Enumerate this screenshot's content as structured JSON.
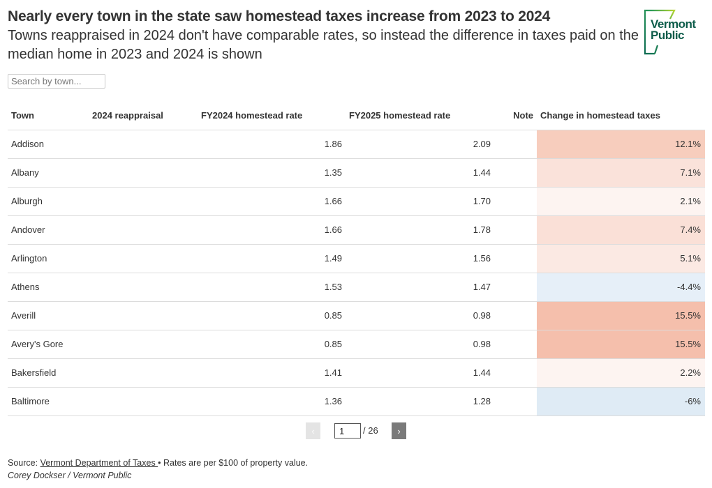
{
  "header": {
    "title": "Nearly every town in the state saw homestead taxes increase from 2023 to 2024",
    "subtitle": "Towns reappraised in 2024 don't have comparable rates, so instead the difference in taxes paid on the median home in 2023 and 2024 is shown"
  },
  "logo": {
    "line1": "Vermont",
    "line2": "Public",
    "icon": "vermont-public-logo"
  },
  "search": {
    "placeholder": "Search by town...",
    "value": ""
  },
  "table": {
    "columns": [
      "Town",
      "2024 reappraisal",
      "FY2024 homestead rate",
      "FY2025 homestead rate",
      "Note",
      "Change in homestead taxes"
    ],
    "rows": [
      {
        "town": "Addison",
        "reappraisal": "",
        "fy2024": "1.86",
        "fy2025": "2.09",
        "note": "",
        "change": "12.1%",
        "change_value": 12.1,
        "color": "#f7cdbd"
      },
      {
        "town": "Albany",
        "reappraisal": "",
        "fy2024": "1.35",
        "fy2025": "1.44",
        "note": "",
        "change": "7.1%",
        "change_value": 7.1,
        "color": "#fae2da"
      },
      {
        "town": "Alburgh",
        "reappraisal": "",
        "fy2024": "1.66",
        "fy2025": "1.70",
        "note": "",
        "change": "2.1%",
        "change_value": 2.1,
        "color": "#fdf4f1"
      },
      {
        "town": "Andover",
        "reappraisal": "",
        "fy2024": "1.66",
        "fy2025": "1.78",
        "note": "",
        "change": "7.4%",
        "change_value": 7.4,
        "color": "#fae0d7"
      },
      {
        "town": "Arlington",
        "reappraisal": "",
        "fy2024": "1.49",
        "fy2025": "1.56",
        "note": "",
        "change": "5.1%",
        "change_value": 5.1,
        "color": "#fbe9e3"
      },
      {
        "town": "Athens",
        "reappraisal": "",
        "fy2024": "1.53",
        "fy2025": "1.47",
        "note": "",
        "change": "-4.4%",
        "change_value": -4.4,
        "color": "#e6eff8"
      },
      {
        "town": "Averill",
        "reappraisal": "",
        "fy2024": "0.85",
        "fy2025": "0.98",
        "note": "",
        "change": "15.5%",
        "change_value": 15.5,
        "color": "#f5bfac"
      },
      {
        "town": "Avery's Gore",
        "reappraisal": "",
        "fy2024": "0.85",
        "fy2025": "0.98",
        "note": "",
        "change": "15.5%",
        "change_value": 15.5,
        "color": "#f5bfac"
      },
      {
        "town": "Bakersfield",
        "reappraisal": "",
        "fy2024": "1.41",
        "fy2025": "1.44",
        "note": "",
        "change": "2.2%",
        "change_value": 2.2,
        "color": "#fdf4f1"
      },
      {
        "town": "Baltimore",
        "reappraisal": "",
        "fy2024": "1.36",
        "fy2025": "1.28",
        "note": "",
        "change": "-6%",
        "change_value": -6,
        "color": "#dfebf5"
      }
    ]
  },
  "pagination": {
    "current_page": "1",
    "total_label": "/ 26",
    "prev_icon": "‹",
    "next_icon": "›"
  },
  "footer": {
    "source_prefix": "Source: ",
    "source_link": "Vermont Department of Taxes ",
    "source_suffix": "• Rates are per $100 of property value.",
    "byline": "Corey Dockser / Vermont Public"
  }
}
